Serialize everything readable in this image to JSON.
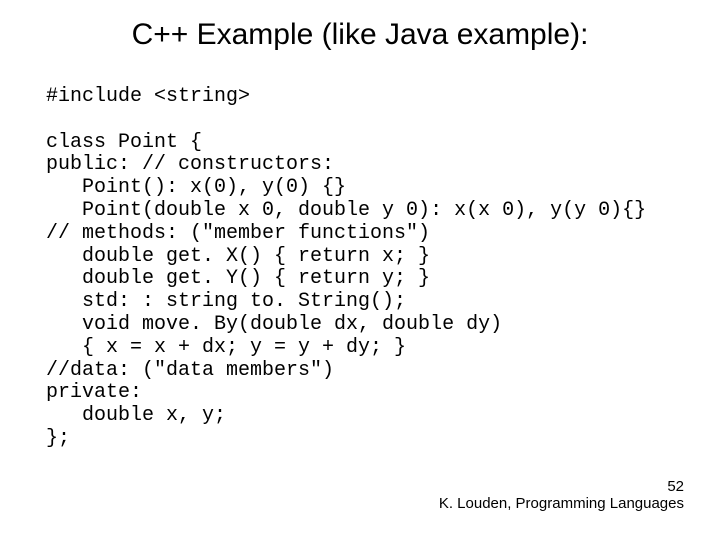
{
  "slide": {
    "title": "C++ Example (like Java example):",
    "code_lines": [
      "#include <string>",
      "",
      "class Point {",
      "public: // constructors:",
      "   Point(): x(0), y(0) {}",
      "   Point(double x 0, double y 0): x(x 0), y(y 0){}",
      "// methods: (\"member functions\")",
      "   double get. X() { return x; }",
      "   double get. Y() { return y; }",
      "   std: : string to. String();",
      "   void move. By(double dx, double dy)",
      "   { x = x + dx; y = y + dy; }",
      "//data: (\"data members\")",
      "private:",
      "   double x, y;",
      "};"
    ],
    "footer": {
      "page_number": "52",
      "attribution": "K. Louden, Programming Languages"
    }
  }
}
